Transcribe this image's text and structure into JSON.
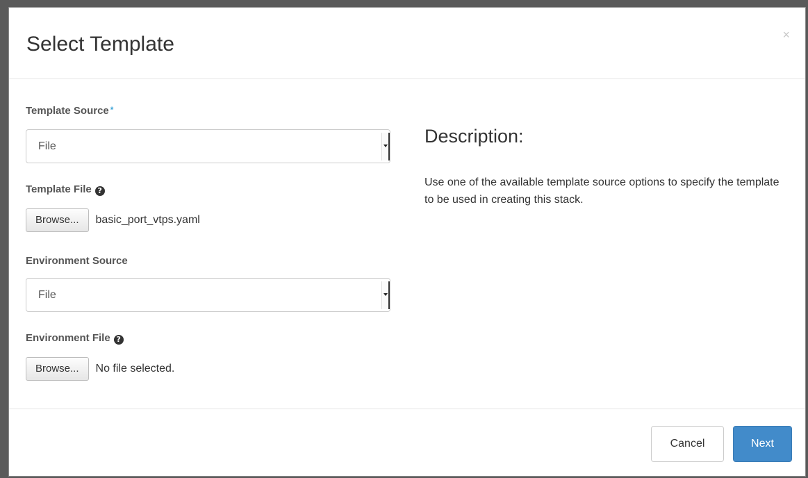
{
  "dialog": {
    "title": "Select Template",
    "close_symbol": "×"
  },
  "form": {
    "template_source": {
      "label": "Template Source",
      "required_marker": "*",
      "selected_value": "File"
    },
    "template_file": {
      "label": "Template File",
      "help_icon": "question-circle-icon",
      "browse_label": "Browse...",
      "file_name": "basic_port_vtps.yaml"
    },
    "environment_source": {
      "label": "Environment Source",
      "selected_value": "File"
    },
    "environment_file": {
      "label": "Environment File",
      "help_icon": "question-circle-icon",
      "browse_label": "Browse...",
      "file_name": "No file selected."
    }
  },
  "description": {
    "heading": "Description:",
    "text": "Use one of the available template source options to specify the template to be used in creating this stack."
  },
  "footer": {
    "cancel_label": "Cancel",
    "next_label": "Next"
  },
  "colors": {
    "primary": "#428bca",
    "required": "#3ea5d8"
  }
}
